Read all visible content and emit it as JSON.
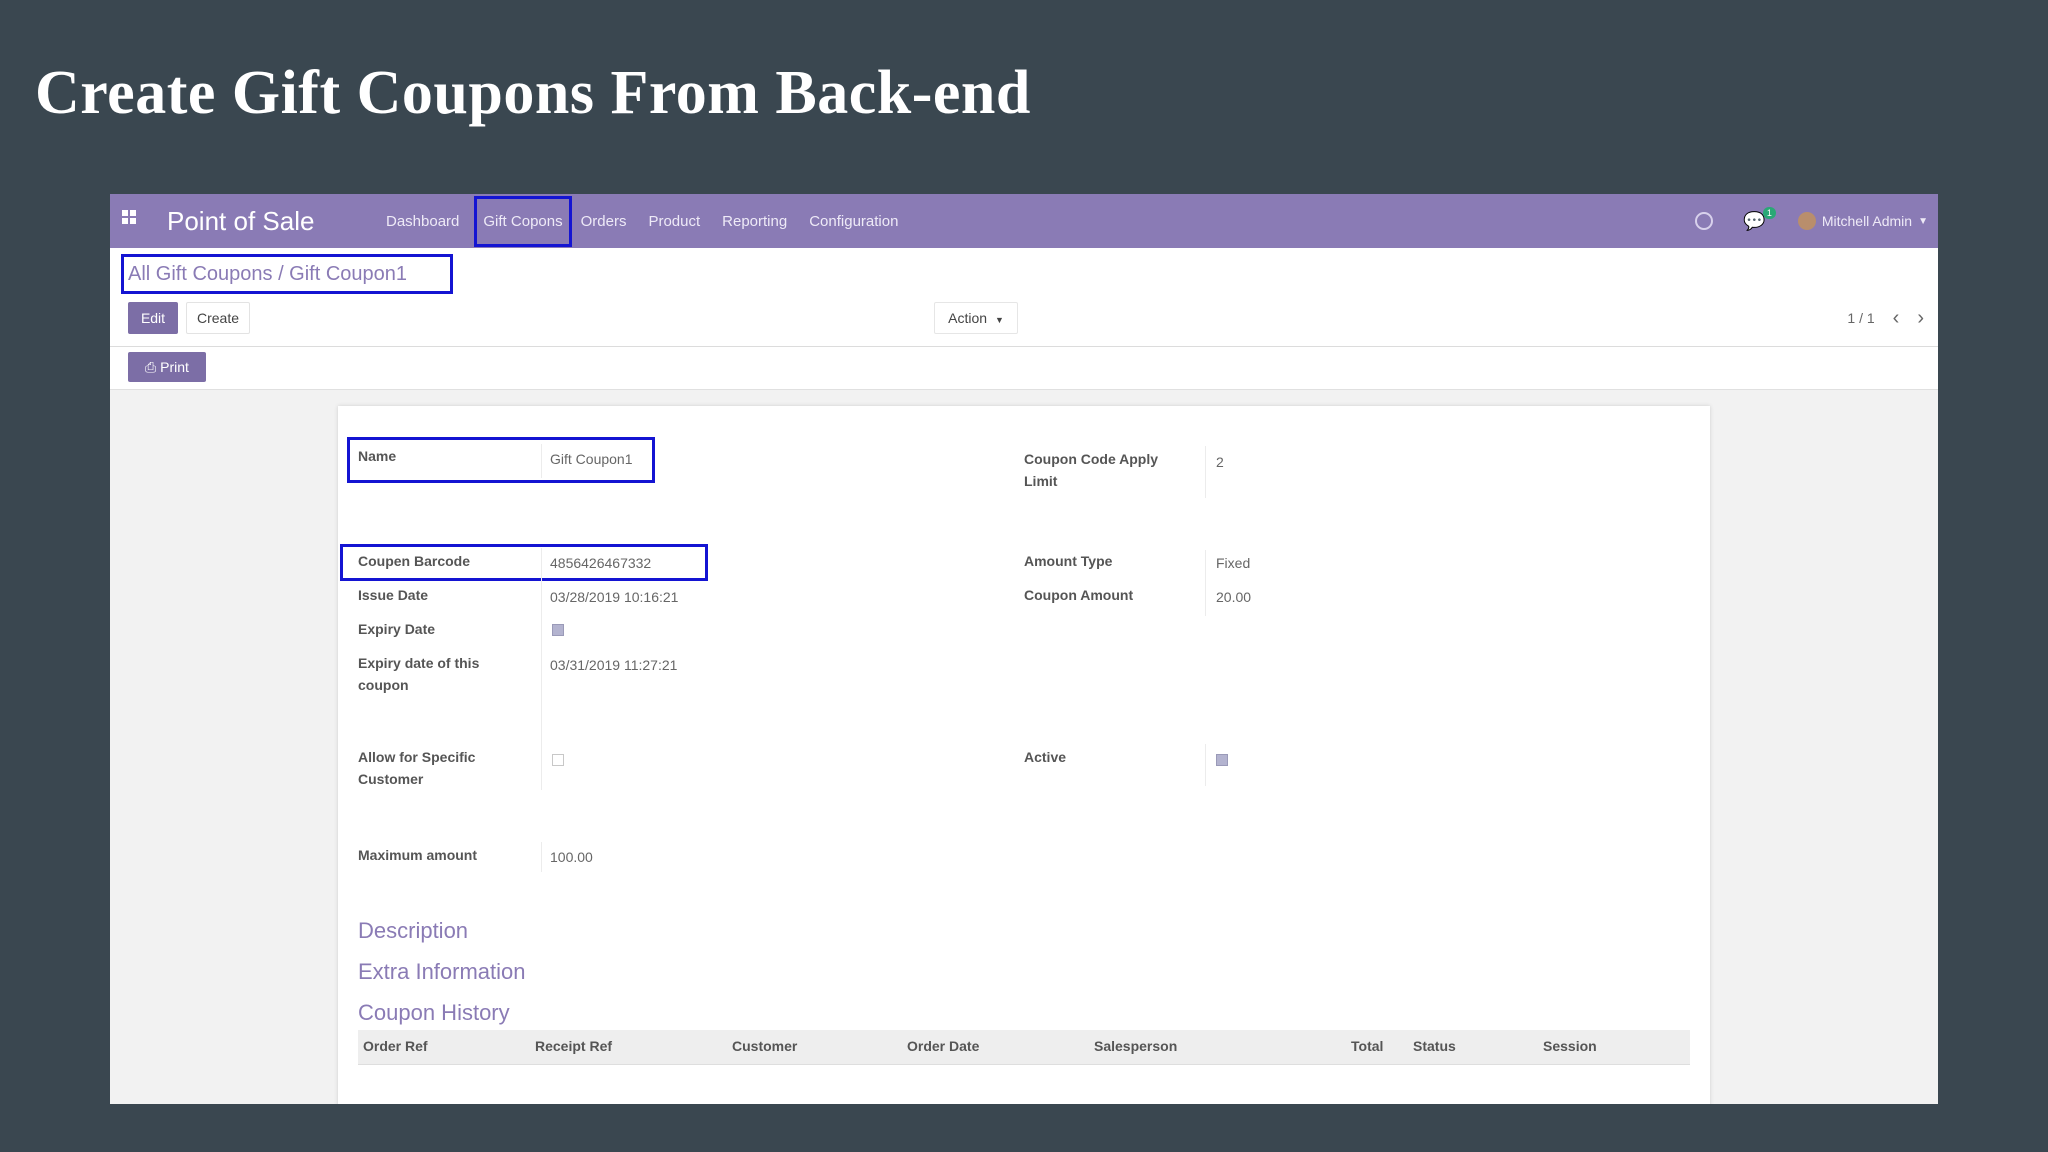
{
  "slide": {
    "title": "Create Gift Coupons From Back-end"
  },
  "navbar": {
    "app_name": "Point of Sale",
    "menu": [
      "Dashboard",
      "Gift Copons",
      "Orders",
      "Product",
      "Reporting",
      "Configuration"
    ],
    "chat_badge": "1",
    "user": "Mitchell Admin",
    "accent_color": "#8a7bb5"
  },
  "control_panel": {
    "breadcrumb": "All Gift Coupons / Gift Coupon1",
    "edit_label": "Edit",
    "create_label": "Create",
    "action_label": "Action",
    "pager": "1 / 1"
  },
  "statusbar": {
    "print_label": "Print"
  },
  "form": {
    "name_label": "Name",
    "name_value": "Gift Coupon1",
    "barcode_label": "Coupen Barcode",
    "barcode_value": "4856426467332",
    "issue_date_label": "Issue Date",
    "issue_date_value": "03/28/2019 10:16:21",
    "expiry_date_label": "Expiry Date",
    "expiry_date_checked": true,
    "expiry_of_coupon_label": "Expiry date of this coupon",
    "expiry_of_coupon_value": "03/31/2019 11:27:21",
    "specific_customer_label": "Allow for Specific Customer",
    "specific_customer_checked": false,
    "max_amount_label": "Maximum amount",
    "max_amount_value": "100.00",
    "apply_limit_label": "Coupon Code Apply Limit",
    "apply_limit_value": "2",
    "amount_type_label": "Amount Type",
    "amount_type_value": "Fixed",
    "coupon_amount_label": "Coupon Amount",
    "coupon_amount_value": "20.00",
    "active_label": "Active",
    "active_checked": true
  },
  "sections": [
    "Description",
    "Extra Information",
    "Coupon History"
  ],
  "history_table": {
    "columns": [
      "Order Ref",
      "Receipt Ref",
      "Customer",
      "Order Date",
      "Salesperson",
      "Total",
      "Status",
      "Session"
    ]
  }
}
